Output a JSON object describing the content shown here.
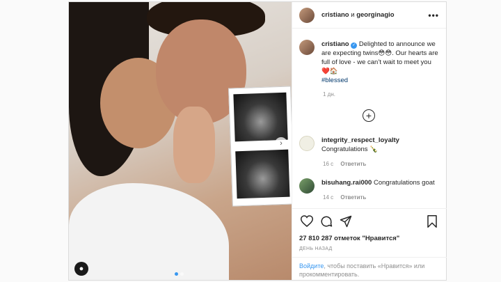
{
  "post": {
    "header": {
      "author1": "cristiano",
      "separator": "и",
      "author2": "georginagio",
      "more": "•••"
    },
    "caption": {
      "username": "cristiano",
      "text": "Delighted to announce we are expecting twins😳😳. Our hearts are full of love - we can’t wait to meet you",
      "emoji": "❤️🏠",
      "hashtag": "#blessed",
      "time": "1 дн."
    },
    "load_more": "+",
    "comments": [
      {
        "username": "integrity_respect_loyalty",
        "text": "Congratulations 🍾",
        "time": "16 с",
        "reply": "Ответить"
      },
      {
        "username": "bisuhang.rai000",
        "text": "Congratulations goat",
        "time": "14 с",
        "reply": "Ответить"
      }
    ],
    "likes": "27 810 287 отметок \"Нравится\"",
    "posted_ago": "ДЕНЬ НАЗАД",
    "login_prompt": {
      "link": "Войдите",
      "rest": ", чтобы поставить «Нравится» или прокомментировать."
    },
    "photo": {
      "tagged_icon": "person-icon",
      "next_icon": "chevron-right-icon",
      "carousel_count": 2,
      "carousel_active": 1
    },
    "icons": [
      "heart-icon",
      "comment-icon",
      "share-icon",
      "bookmark-icon"
    ],
    "colors": {
      "link": "#3897f0",
      "verified": "#3897f0",
      "muted": "#8e8e8e"
    }
  }
}
